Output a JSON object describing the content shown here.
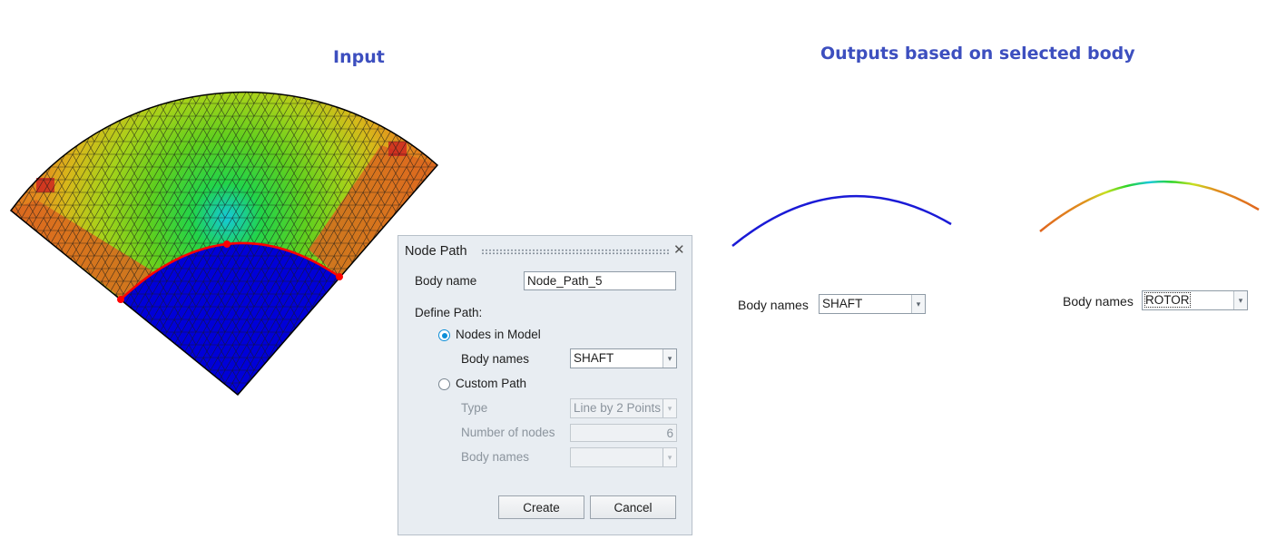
{
  "headings": {
    "input": "Input",
    "outputs": "Outputs based on selected body"
  },
  "dialog": {
    "title": "Node Path",
    "close_glyph": "✕",
    "body_name_label": "Body name",
    "body_name_value": "Node_Path_5",
    "define_path_label": "Define Path:",
    "nodes_in_model_label": "Nodes in Model",
    "nodes_in_model_selected": true,
    "nodes_body_names_label": "Body names",
    "nodes_body_names_value": "SHAFT",
    "custom_path_label": "Custom Path",
    "custom_path_selected": false,
    "type_label": "Type",
    "type_value": "Line by 2 Points",
    "number_of_nodes_label": "Number of nodes",
    "number_of_nodes_value": "6",
    "custom_body_names_label": "Body names",
    "custom_body_names_value": "",
    "create_label": "Create",
    "cancel_label": "Cancel",
    "dropdown_glyph": "▾"
  },
  "outputs": {
    "shaft": {
      "label": "Body names",
      "value": "SHAFT",
      "curve_color": "#1a1ad6"
    },
    "rotor": {
      "label": "Body names",
      "value": "ROTOR"
    }
  },
  "colors": {
    "heading": "#3d4fbf",
    "mesh_inner_body": "#0000d8",
    "mesh_outer_body": "#d9661e",
    "path_highlight": "#ff0000"
  },
  "icons": {
    "close": "close-icon",
    "dropdown": "chevron-down-icon",
    "grip": "drag-handle-icon"
  }
}
